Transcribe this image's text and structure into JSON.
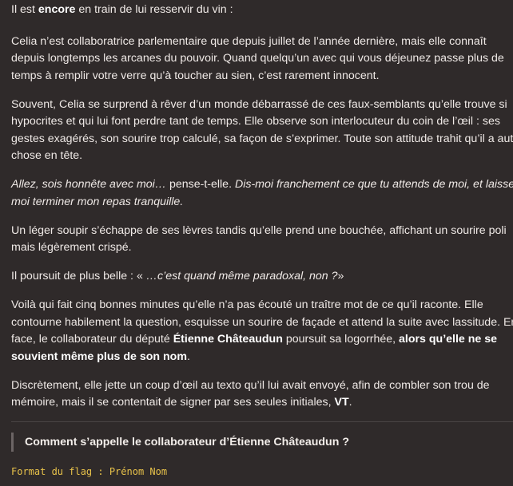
{
  "paragraphs": {
    "p1": {
      "a": "Il est ",
      "b": "encore",
      "c": " en train de lui resservir du vin :"
    },
    "p2": {
      "l1": "Celia n’est collaboratrice parlementaire que depuis juillet de l’année dernière, mais elle connaît",
      "l2": "depuis longtemps les arcanes du pouvoir. Quand quelqu’un avec qui vous déjeunez passe plus de",
      "l3": "temps à remplir votre verre qu’à toucher au sien, c’est rarement innocent."
    },
    "p3": {
      "l1": "Souvent, Celia se surprend à rêver d’un monde débarrassé de ces faux-semblants qu’elle trouve si",
      "l2": "hypocrites et qui lui font perdre tant de temps. Elle observe son interlocuteur du coin de l’œil : ses",
      "l3": "gestes exagérés, son sourire trop calculé, sa façon de s’exprimer. Toute son attitude trahit qu’il a autre",
      "l4": "chose en tête."
    },
    "p4": {
      "l1a": "Allez, sois honnête avec moi…",
      "l1b": " pense-t-elle. ",
      "l1c": "Dis-moi franchement ce que tu attends de moi, et laisse-",
      "l2": "moi terminer mon repas tranquille."
    },
    "p5": {
      "l1": "Un léger soupir s’échappe de ses lèvres tandis qu’elle prend une bouchée, affichant un sourire poli",
      "l2": "mais légèrement crispé."
    },
    "p6": {
      "a": "Il poursuit de plus belle : « ",
      "b": "…c’est quand même paradoxal, non ?",
      "c": "»"
    },
    "p7": {
      "l1": "Voilà qui fait cinq bonnes minutes qu’elle n’a pas écouté un traître mot de ce qu’il raconte. Elle",
      "l2": "contourne habilement la question, esquisse un sourire de façade et attend la suite avec lassitude. En",
      "l3a": "face, le collaborateur du député ",
      "l3b": "Étienne Châteaudun",
      "l3c": " poursuit sa logorrhée, ",
      "l3d": "alors qu’elle ne se",
      "l4": "souvient même plus de son nom",
      "l4c": "."
    },
    "p8": {
      "l1": "Discrètement, elle jette un coup d’œil au texto qu’il lui avait envoyé, afin de combler son trou de",
      "l2a": "mémoire, mais il se contentait de signer par ses seules initiales, ",
      "l2b": "VT",
      "l2c": "."
    }
  },
  "question": "Comment s’appelle le collaborateur d’Étienne Châteaudun ?",
  "flag_format": "Format du flag : Prénom Nom",
  "colors": {
    "background": "#2f2a2a",
    "text": "#efe9e6",
    "flag": "#e8c24a",
    "quote_bar": "#6b6464"
  }
}
